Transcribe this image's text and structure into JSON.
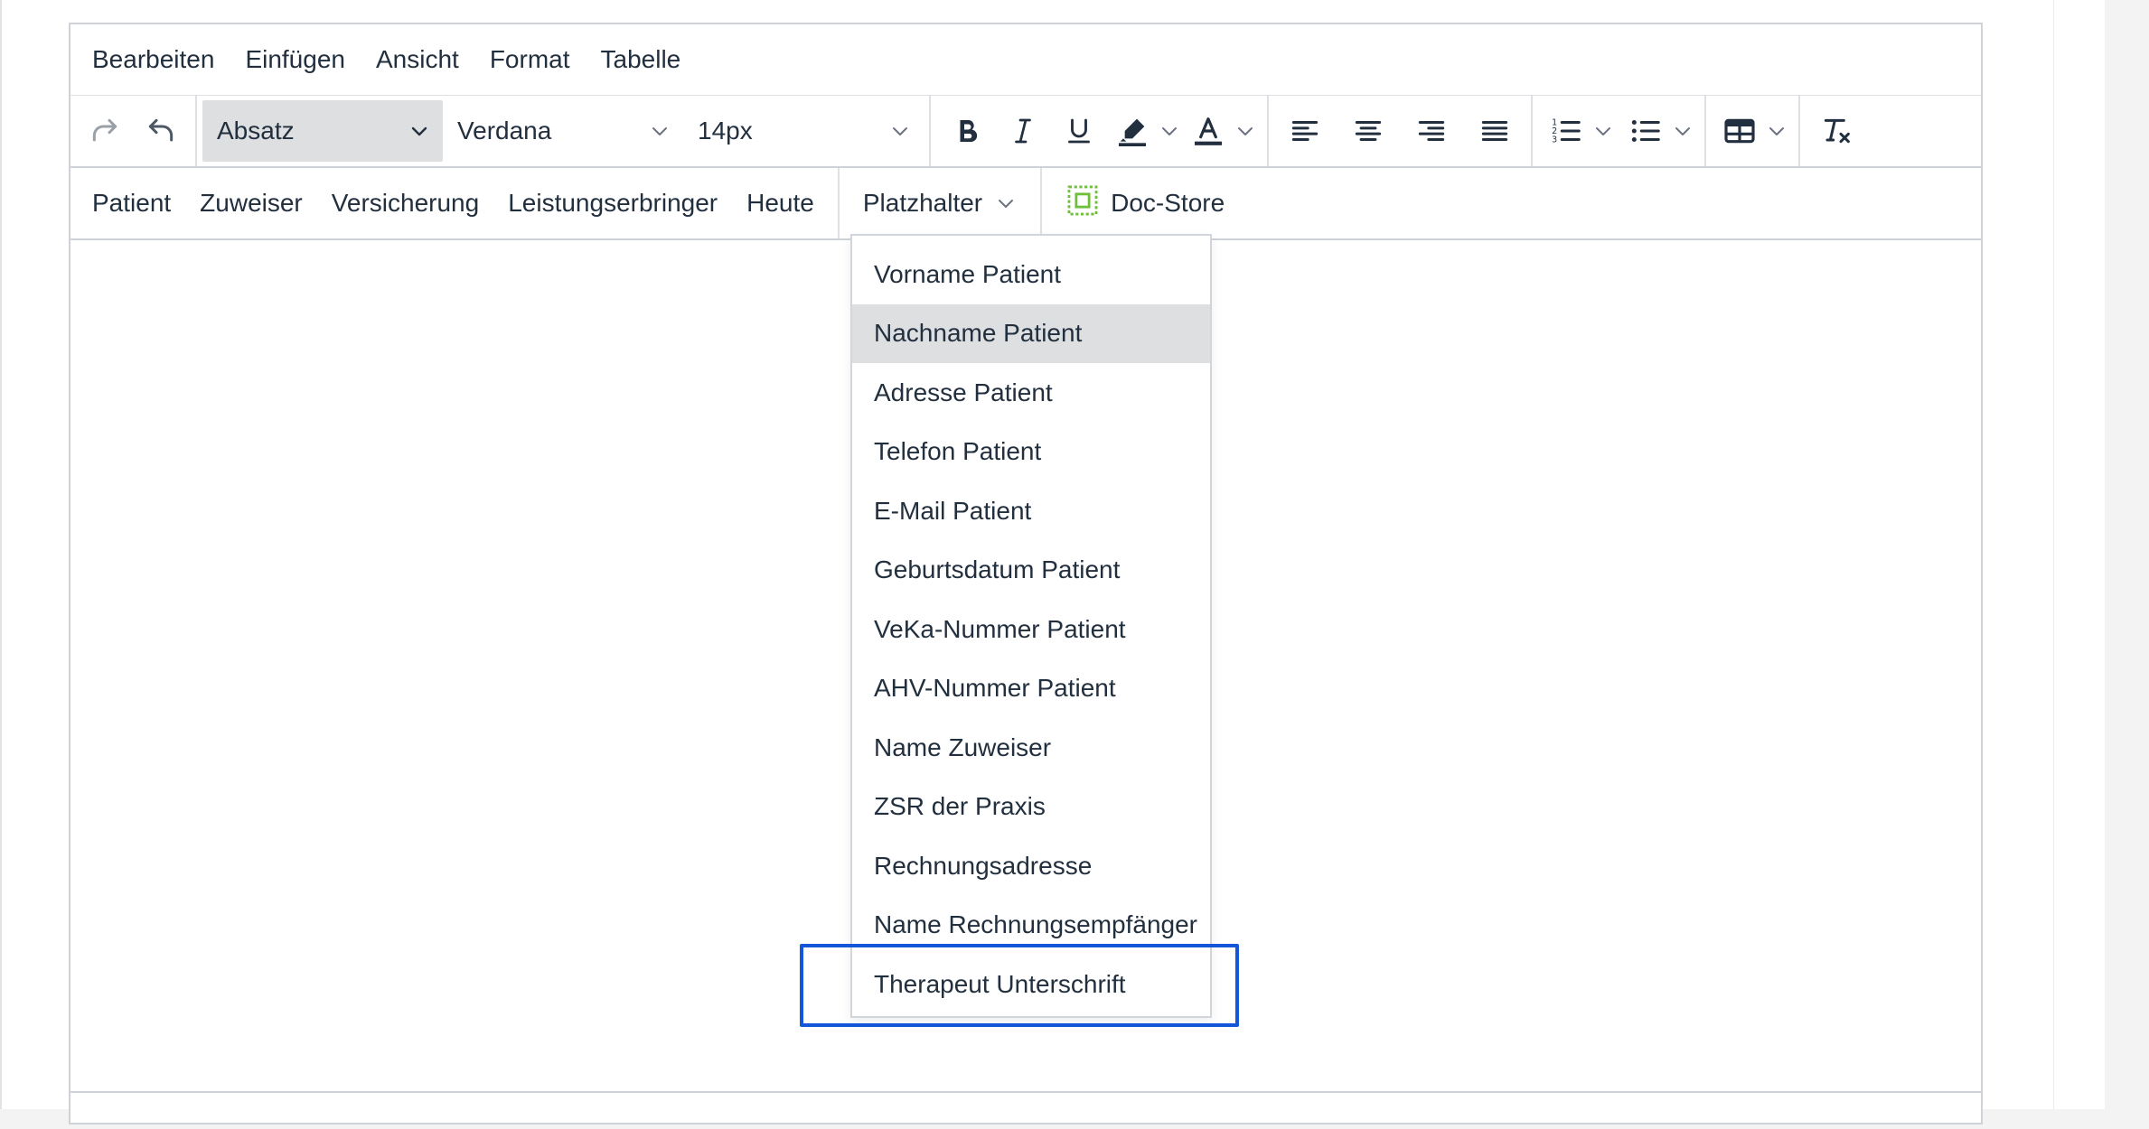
{
  "menubar": {
    "items": [
      "Bearbeiten",
      "Einfügen",
      "Ansicht",
      "Format",
      "Tabelle"
    ]
  },
  "toolbar": {
    "block_format": "Absatz",
    "font_family": "Verdana",
    "font_size": "14px",
    "icons": {
      "redo": "redo-icon",
      "undo": "undo-icon",
      "bold": "bold-icon",
      "italic": "italic-icon",
      "underline": "underline-icon",
      "highlight": "highlight-icon",
      "text_color": "text-color-icon",
      "align_left": "align-left-icon",
      "align_center": "align-center-icon",
      "align_right": "align-right-icon",
      "justify": "justify-icon",
      "numbered_list": "numbered-list-icon",
      "bullet_list": "bullet-list-icon",
      "table": "table-icon",
      "clear_format": "clear-format-icon"
    }
  },
  "placeholders_bar": {
    "items": [
      "Patient",
      "Zuweiser",
      "Versicherung",
      "Leistungserbringer",
      "Heute"
    ],
    "placeholder_menu": "Platzhalter",
    "doc_store": "Doc-Store",
    "doc_store_color": "#6fbf3b"
  },
  "dropdown": {
    "items": [
      "Vorname Patient",
      "Nachname Patient",
      "Adresse Patient",
      "Telefon Patient",
      "E-Mail Patient",
      "Geburtsdatum Patient",
      "VeKa-Nummer Patient",
      "AHV-Nummer Patient",
      "Name Zuweiser",
      "ZSR der Praxis",
      "Rechnungsadresse",
      "Name Rechnungsempfänger",
      "Therapeut Unterschrift"
    ],
    "hovered": "Nachname Patient",
    "highlighted": "Therapeut Unterschrift",
    "highlight_color": "#1456d8"
  }
}
